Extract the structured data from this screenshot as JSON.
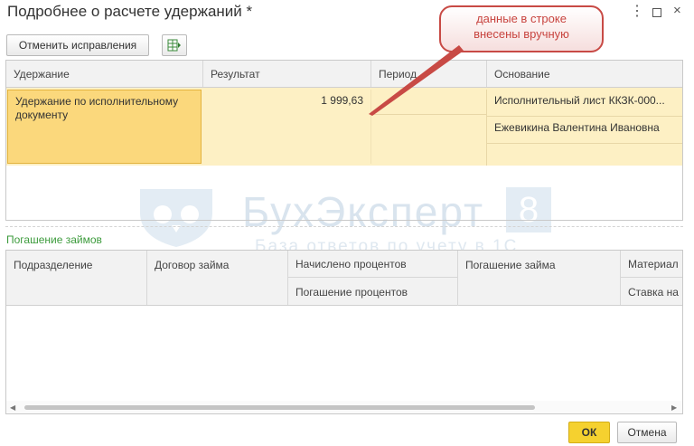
{
  "window": {
    "title": "Подробнее о расчете удержаний *",
    "more_icon": "more-icon",
    "maximize_icon": "maximize-icon",
    "close_icon": "close-icon"
  },
  "toolbar": {
    "revert_label": "Отменить исправления",
    "export_icon": "spreadsheet-export-icon"
  },
  "callout": {
    "text_line1": "данные в строке",
    "text_line2": "внесены вручную"
  },
  "deductions": {
    "columns": [
      "Удержание",
      "Результат",
      "Период",
      "Основание"
    ],
    "row": {
      "deduction": "Удержание по исполнительному документу",
      "result": "1 999,63",
      "period": "",
      "basis_1": "Исполнительный лист ККЗК-000...",
      "basis_2": "Ежевикина Валентина Ивановна"
    }
  },
  "watermark": {
    "brand": "БухЭксперт",
    "digit": "8",
    "subtitle": "База ответов по учету в 1С"
  },
  "loans": {
    "section_title": "Погашение займов",
    "columns": {
      "division": "Подразделение",
      "contract": "Договор займа",
      "interest_accrued": "Начислено процентов",
      "interest_repayment": "Погашение процентов",
      "loan_repayment": "Погашение займа",
      "material_benefit": "Материал",
      "rate": "Ставка на"
    }
  },
  "footer": {
    "ok_label": "ОК",
    "cancel_label": "Отмена"
  },
  "colors": {
    "selected_row": "#fdf0c4",
    "selected_cell": "#fbd87c",
    "ok_button": "#f5d12f",
    "section_green": "#3c9b3c",
    "callout_red": "#c84a45"
  }
}
